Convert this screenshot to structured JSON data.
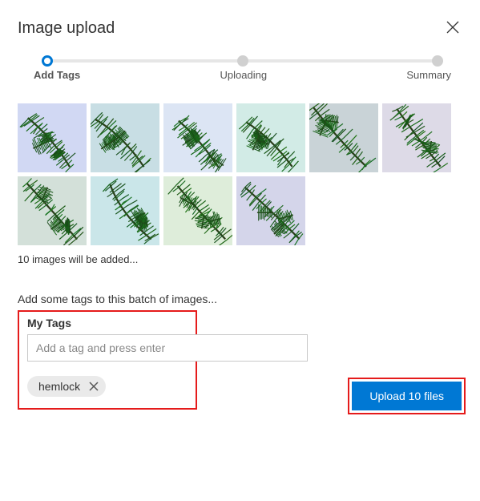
{
  "dialog": {
    "title": "Image upload"
  },
  "progress": {
    "steps": [
      "Add Tags",
      "Uploading",
      "Summary"
    ],
    "active": 0
  },
  "thumbnails": {
    "count": 10
  },
  "status_text": "10 images will be added...",
  "prompt_text": "Add some tags to this batch of images...",
  "tags": {
    "label": "My Tags",
    "input_placeholder": "Add a tag and press enter",
    "chips": [
      "hemlock"
    ]
  },
  "footer": {
    "upload_label": "Upload 10 files"
  }
}
